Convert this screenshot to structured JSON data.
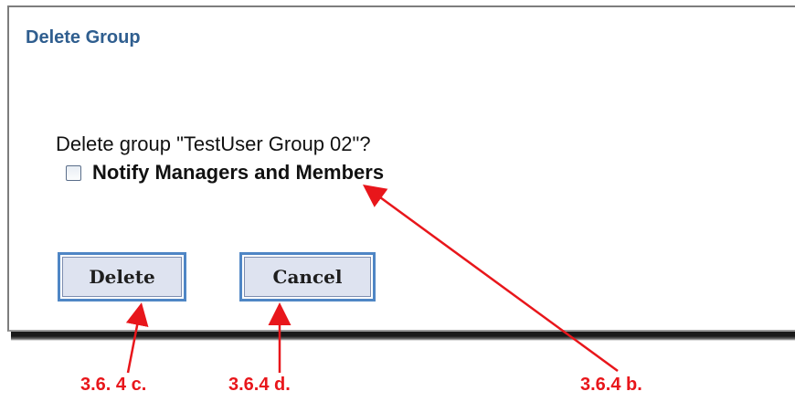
{
  "dialog": {
    "title": "Delete Group",
    "question": "Delete group \"TestUser Group 02\"?",
    "notify_checkbox": {
      "label": "Notify Managers and Members",
      "checked": false
    },
    "buttons": {
      "delete_label": "Delete",
      "cancel_label": "Cancel"
    }
  },
  "annotations": {
    "delete_callout": "3.6. 4 c.",
    "cancel_callout": "3.6.4 d.",
    "notify_callout": "3.6.4 b.",
    "arrow_color": "#e8161b"
  },
  "colors": {
    "title": "#2f5e8f",
    "button_border": "#4f86c5",
    "button_fill": "#dee3f0"
  }
}
